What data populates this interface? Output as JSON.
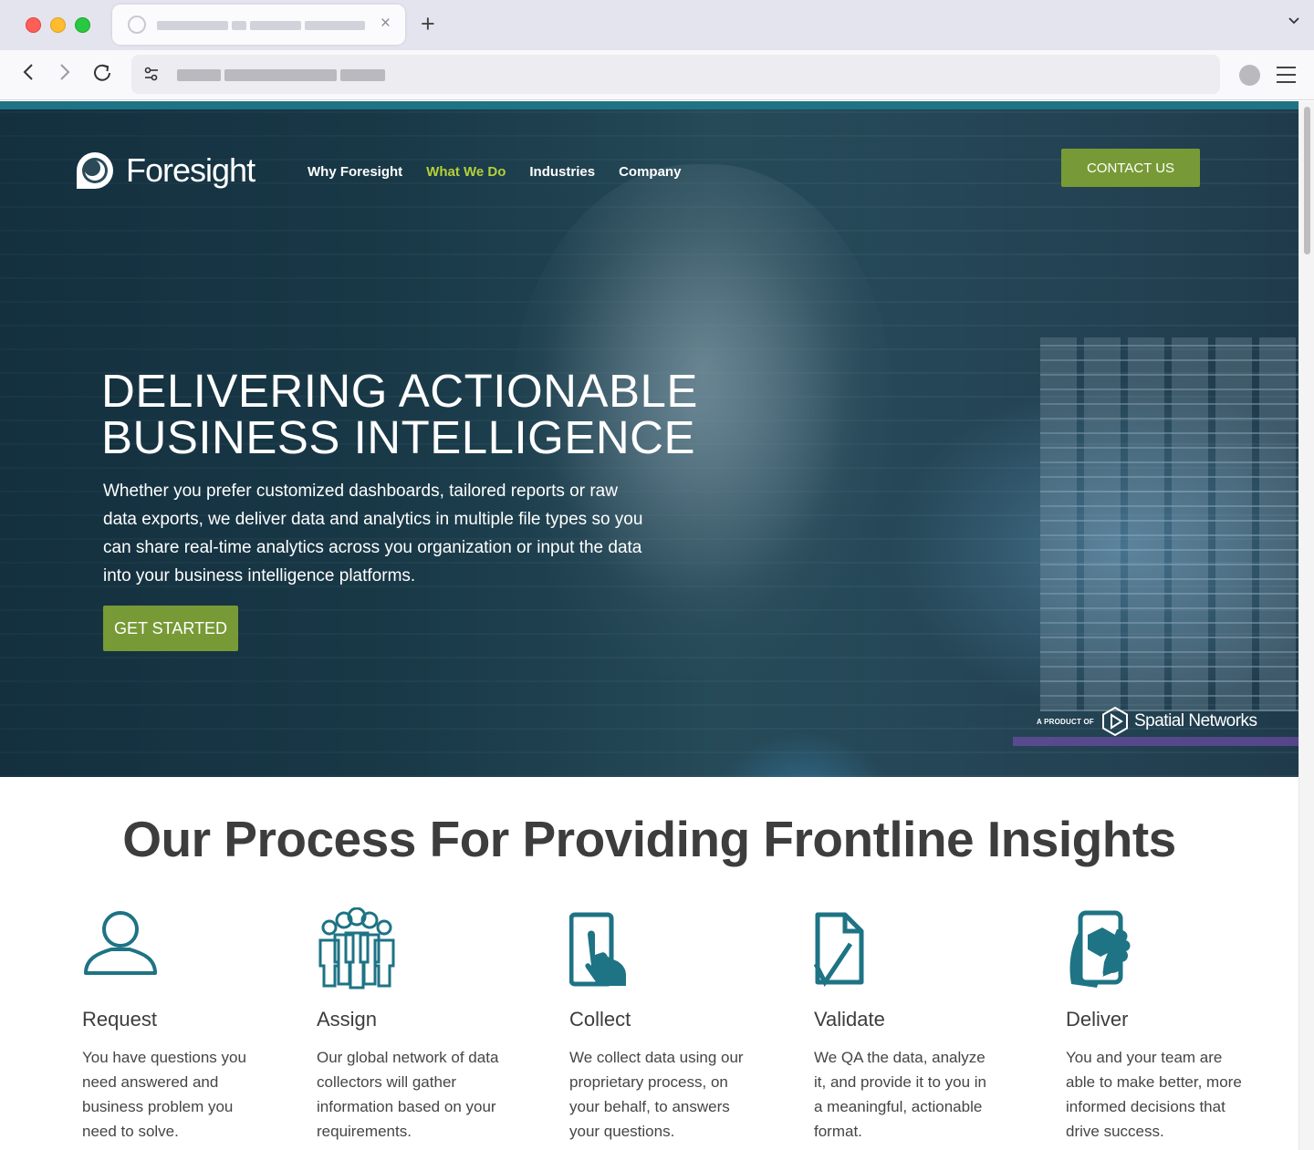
{
  "browser": {
    "new_tab": "+",
    "tab_close": "×"
  },
  "site": {
    "brand": "Foresight",
    "nav": [
      "Why Foresight",
      "What We Do",
      "Industries",
      "Company"
    ],
    "nav_active": "What We Do",
    "contact_label": "CONTACT US",
    "accent_color": "#779a36",
    "teal_color": "#1e7384"
  },
  "hero": {
    "title_line1": "DELIVERING ACTIONABLE",
    "title_line2": "BUSINESS INTELLIGENCE",
    "description": "Whether you prefer customized dashboards, tailored reports or raw data exports, we deliver data and analytics in multiple file types so you can share real-time analytics across you organization or input the data  into your business intelligence platforms.",
    "cta_label": "GET STARTED",
    "product_of_label": "A PRODUCT OF",
    "product_of_brand": "Spatial Networks"
  },
  "process": {
    "title": "Our Process For Providing Frontline Insights",
    "steps": [
      {
        "icon": "person-icon",
        "title": "Request",
        "description": "You have questions you need answered and business problem you need to solve."
      },
      {
        "icon": "group-icon",
        "title": "Assign",
        "description": "Our global network of data collectors will gather information based on your requirements."
      },
      {
        "icon": "tablet-tap-icon",
        "title": "Collect",
        "description": "We collect data using our proprietary process, on your behalf, to answers your questions."
      },
      {
        "icon": "document-check-icon",
        "title": "Validate",
        "description": "We QA the data, analyze it, and provide it to you in a meaningful, actionable format."
      },
      {
        "icon": "phone-in-hand-icon",
        "title": "Deliver",
        "description": "You and your team are able to make better, more informed decisions that drive success."
      }
    ]
  }
}
